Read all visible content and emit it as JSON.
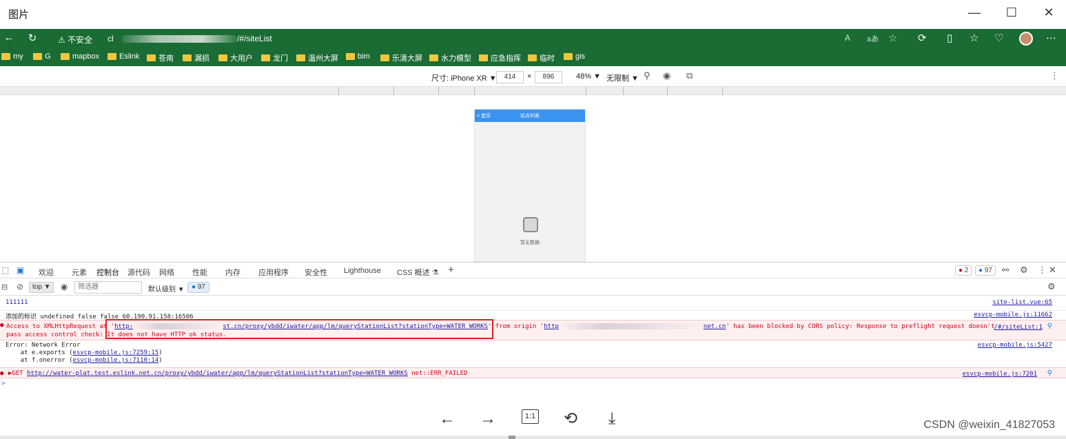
{
  "viewer": {
    "title": "图片",
    "minimize": "—",
    "maximize": "☐",
    "close": "✕",
    "watermark": "CSDN @weixin_41827053",
    "controls": {
      "prev": "←",
      "next": "→",
      "actual_size": "1:1",
      "rotate": "⟲",
      "download": "⤓"
    }
  },
  "browser": {
    "back": "←",
    "reload": "↻",
    "security": "⚠ 不安全",
    "url": "/#/siteList",
    "url_prefix": "cl",
    "bookmarks": [
      "my",
      "G",
      "mapbox",
      "Eslink",
      "苍南",
      "漏损",
      "大用户",
      "龙门",
      "温州大屏",
      "bim",
      "乐清大屏",
      "水力模型",
      "应急指挥",
      "临时",
      "gis"
    ],
    "right_icons": [
      "A",
      "aあ",
      "☆",
      "⟳",
      "▯",
      "☆",
      "♡"
    ]
  },
  "device_toolbar": {
    "device_label": "尺寸: iPhone XR ▼",
    "width": "414",
    "x": "×",
    "height": "896",
    "zoom": "48% ▼",
    "throttle": "无限制 ▼",
    "more": "⋮"
  },
  "phone": {
    "back": "< 首页",
    "title": "站点列表",
    "empty_text": "暂无数据"
  },
  "devtools": {
    "tabs": [
      "欢迎",
      "元素",
      "控制台",
      "源代码",
      "网络",
      "性能",
      "内存",
      "应用程序",
      "安全性",
      "Lighthouse",
      "CSS 概述 ⚗"
    ],
    "active_tab": "控制台",
    "error_count": "2",
    "msg_count": "97",
    "filter": {
      "context": "top ▼",
      "placeholder": "筛选器",
      "level": "默认级别 ▼",
      "issues": "97"
    },
    "console": [
      {
        "text": "111111",
        "source": "site-list.vue:65"
      },
      {
        "text": "添加的标识 undefined false false 60.190.91.158:16506",
        "source": "esvcp-mobile.js:11662"
      },
      {
        "pre": "Access to XMLHttpRequest at '",
        "url_a": "http:",
        "url_b": "st.cn/proxy/ybdd/iwater/app/lm/queryStationList?stationType=WATER_WORKS",
        "mid": "' from origin '",
        "origin_a": "http",
        "origin_b": "net.cn",
        "post": "' has been blocked by CORS policy: Response to preflight request doesn't",
        "line2": "pass access control check: It does not have HTTP ok status.",
        "source": "/#/siteList:1"
      },
      {
        "text": "Error: Network Error",
        "source": "esvcp-mobile.js:5427"
      },
      {
        "pre": "    at e.exports (",
        "link": "esvcp-mobile.js:7259:15",
        "post": ")"
      },
      {
        "pre": "    at f.onerror (",
        "link": "esvcp-mobile.js:7110:14",
        "post": ")"
      },
      {
        "pre": "▶GET ",
        "url": "http://water-plat.test.eslink.net.cn/proxy/ybdd/iwater/app/lm/queryStationList?stationType=WATER_WORKS",
        "post": " net::ERR_FAILED",
        "source": "esvcp-mobile.js:7201"
      }
    ],
    "prompt": ">"
  }
}
